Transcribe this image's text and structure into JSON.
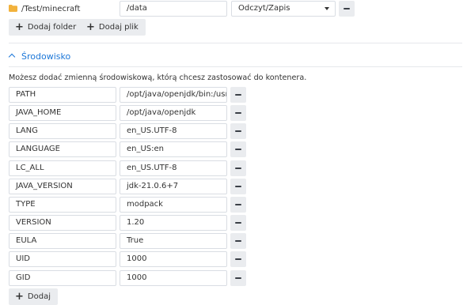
{
  "volume": {
    "folder_path": "/Test/minecraft",
    "mount_path": "/data",
    "permission": "Odczyt/Zapis",
    "folder_icon_color": "#f2b23c"
  },
  "buttons": {
    "add_folder": "Dodaj folder",
    "add_file": "Dodaj plik",
    "add": "Dodaj"
  },
  "environment": {
    "section_title": "Środowisko",
    "description": "Możesz dodać zmienną środowiskową, którą chcesz zastosować do kontenera.",
    "variables": [
      {
        "name": "PATH",
        "value": "/opt/java/openjdk/bin:/usr"
      },
      {
        "name": "JAVA_HOME",
        "value": "/opt/java/openjdk"
      },
      {
        "name": "LANG",
        "value": "en_US.UTF-8"
      },
      {
        "name": "LANGUAGE",
        "value": "en_US:en"
      },
      {
        "name": "LC_ALL",
        "value": "en_US.UTF-8"
      },
      {
        "name": "JAVA_VERSION",
        "value": "jdk-21.0.6+7"
      },
      {
        "name": "TYPE",
        "value": "modpack"
      },
      {
        "name": "VERSION",
        "value": "1.20"
      },
      {
        "name": "EULA",
        "value": "True"
      },
      {
        "name": "UID",
        "value": "1000"
      },
      {
        "name": "GID",
        "value": "1000"
      }
    ]
  },
  "colors": {
    "accent": "#1c77d8",
    "button_bg": "#eaecef",
    "field_border": "#d9dde3"
  }
}
